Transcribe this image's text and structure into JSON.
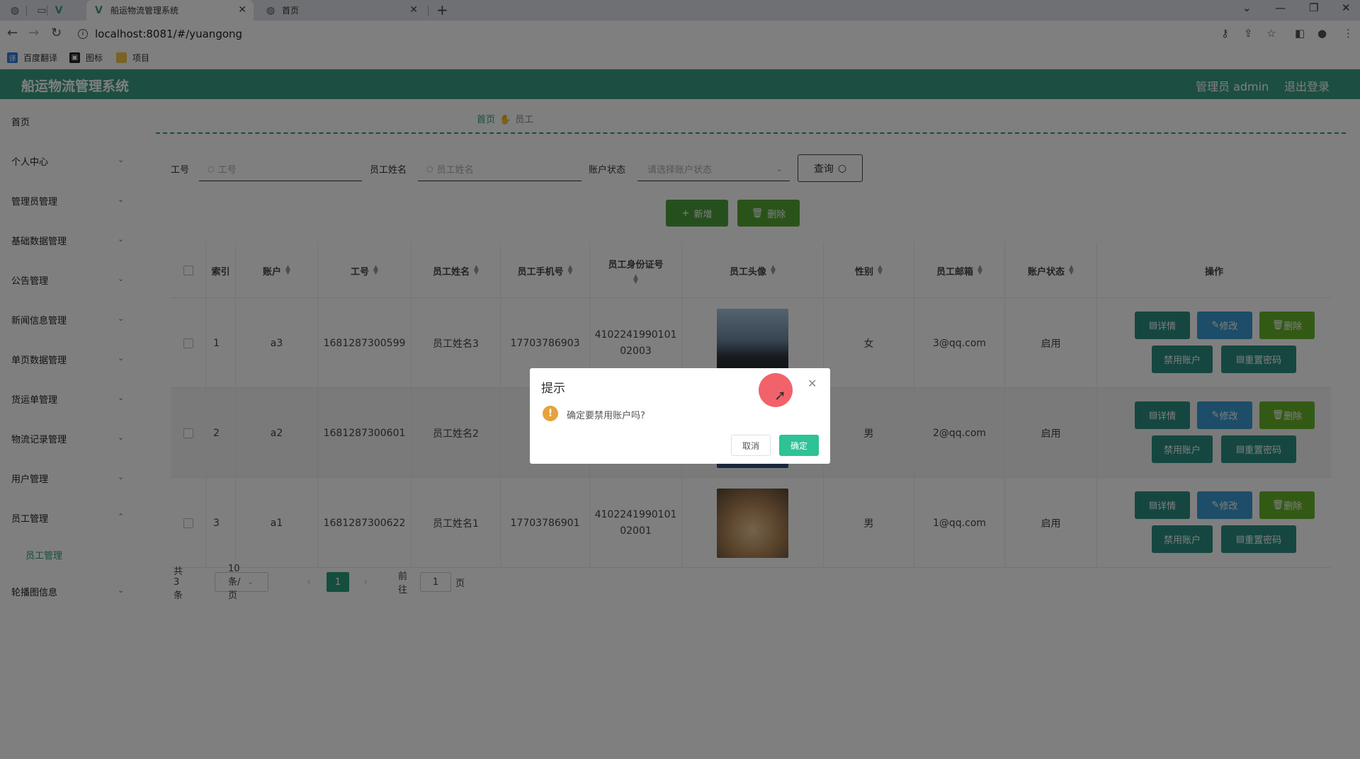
{
  "browser": {
    "tabs": [
      {
        "label": "船运物流管理系统",
        "active": true
      },
      {
        "label": "首页",
        "active": false
      }
    ],
    "url": "localhost:8081/#/yuangong",
    "bookmarks": [
      "百度翻译",
      "图标",
      "项目"
    ]
  },
  "app": {
    "title": "船运物流管理系统",
    "user": "管理员 admin",
    "logout": "退出登录"
  },
  "sidebar": {
    "items": [
      "首页",
      "个人中心",
      "管理员管理",
      "基础数据管理",
      "公告管理",
      "新闻信息管理",
      "单页数据管理",
      "货运单管理",
      "物流记录管理",
      "用户管理",
      "员工管理",
      "轮播图信息"
    ],
    "submenu": "员工管理"
  },
  "breadcrumb": {
    "home": "首页",
    "current": "员工"
  },
  "filters": {
    "id_label": "工号",
    "id_placeholder": "工号",
    "name_label": "员工姓名",
    "name_placeholder": "员工姓名",
    "status_label": "账户状态",
    "status_placeholder": "请选择账户状态",
    "query": "查询"
  },
  "toolbar": {
    "add": "新增",
    "delete": "删除"
  },
  "table": {
    "headers": [
      "索引",
      "账户",
      "工号",
      "员工姓名",
      "员工手机号",
      "员工身份证号",
      "员工头像",
      "性别",
      "员工邮箱",
      "账户状态",
      "操作"
    ],
    "rows": [
      {
        "index": "1",
        "account": "a3",
        "id": "1681287300599",
        "name": "员工姓名3",
        "phone": "17703786903",
        "idcard": "4102241990101\n02003",
        "gender": "女",
        "email": "3@qq.com",
        "status": "启用"
      },
      {
        "index": "2",
        "account": "a2",
        "id": "1681287300601",
        "name": "员工姓名2",
        "phone": "",
        "idcard": "",
        "gender": "男",
        "email": "2@qq.com",
        "status": "启用"
      },
      {
        "index": "3",
        "account": "a1",
        "id": "1681287300622",
        "name": "员工姓名1",
        "phone": "17703786901",
        "idcard": "4102241990101\n02001",
        "gender": "男",
        "email": "1@qq.com",
        "status": "启用"
      }
    ],
    "actions": {
      "detail": "详情",
      "edit": "修改",
      "remove": "删除",
      "disable": "禁用账户",
      "reset": "重置密码"
    }
  },
  "pagination": {
    "total": "共 3 条",
    "page_size": "10条/页",
    "current": "1",
    "goto": "前往",
    "goto_value": "1",
    "page_unit": "页"
  },
  "dialog": {
    "title": "提示",
    "message": "确定要禁用账户吗?",
    "cancel": "取消",
    "confirm": "确定"
  },
  "colors": {
    "header": "#3a9d85",
    "accent": "#2a9d7c",
    "confirm": "#2ec296",
    "warning": "#e6a23c"
  }
}
